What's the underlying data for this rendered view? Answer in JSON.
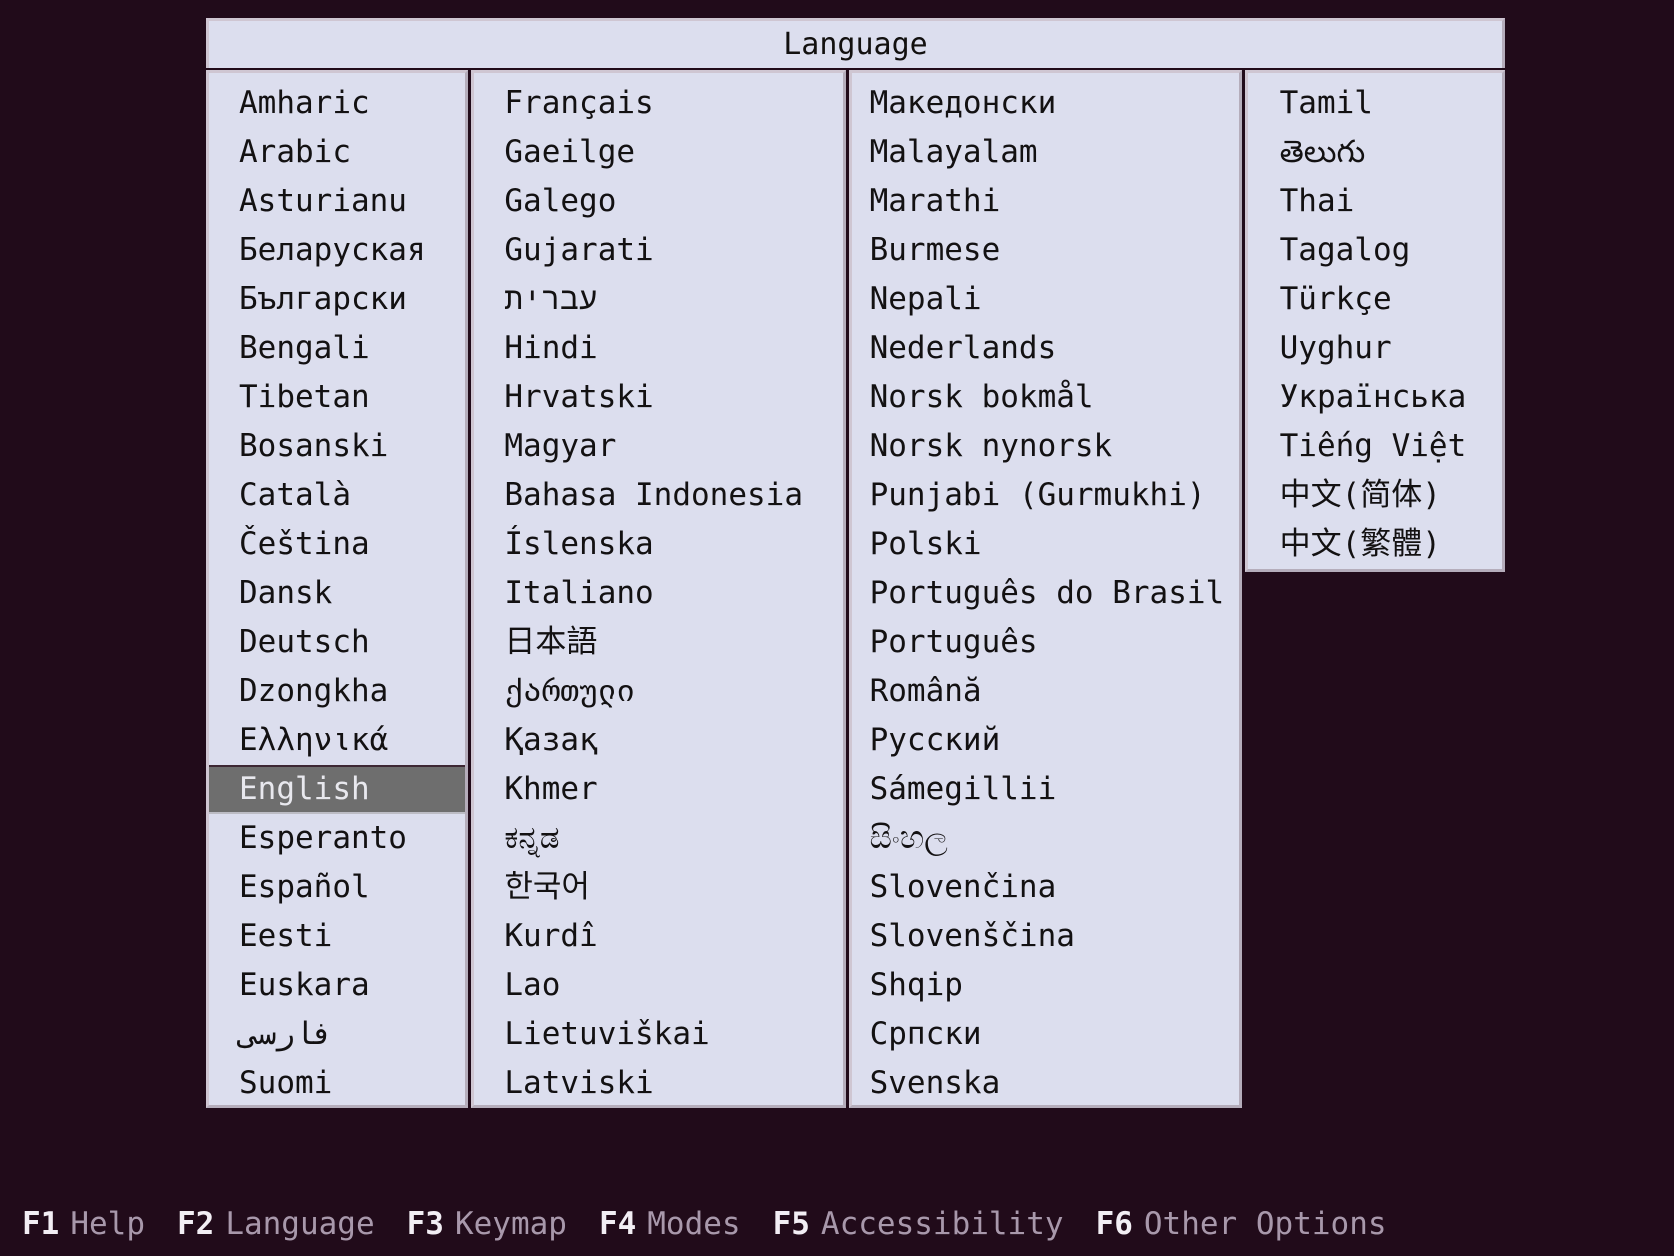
{
  "dialog": {
    "title": "Language",
    "columns": [
      {
        "name": "column-1",
        "items": [
          {
            "label": "Amharic",
            "selected": false
          },
          {
            "label": "Arabic",
            "selected": false
          },
          {
            "label": "Asturianu",
            "selected": false
          },
          {
            "label": "Беларуская",
            "selected": false
          },
          {
            "label": "Български",
            "selected": false
          },
          {
            "label": "Bengali",
            "selected": false
          },
          {
            "label": "Tibetan",
            "selected": false
          },
          {
            "label": "Bosanski",
            "selected": false
          },
          {
            "label": "Català",
            "selected": false
          },
          {
            "label": "Čeština",
            "selected": false
          },
          {
            "label": "Dansk",
            "selected": false
          },
          {
            "label": "Deutsch",
            "selected": false
          },
          {
            "label": "Dzongkha",
            "selected": false
          },
          {
            "label": "Ελληνικά",
            "selected": false
          },
          {
            "label": "English",
            "selected": true
          },
          {
            "label": "Esperanto",
            "selected": false
          },
          {
            "label": "Español",
            "selected": false
          },
          {
            "label": "Eesti",
            "selected": false
          },
          {
            "label": "Euskara",
            "selected": false
          },
          {
            "label": "فارسی",
            "selected": false
          },
          {
            "label": "Suomi",
            "selected": false
          }
        ]
      },
      {
        "name": "column-2",
        "items": [
          {
            "label": "Français",
            "selected": false
          },
          {
            "label": "Gaeilge",
            "selected": false
          },
          {
            "label": "Galego",
            "selected": false
          },
          {
            "label": "Gujarati",
            "selected": false
          },
          {
            "label": "עברית",
            "selected": false
          },
          {
            "label": "Hindi",
            "selected": false
          },
          {
            "label": "Hrvatski",
            "selected": false
          },
          {
            "label": "Magyar",
            "selected": false
          },
          {
            "label": "Bahasa Indonesia",
            "selected": false
          },
          {
            "label": "Íslenska",
            "selected": false
          },
          {
            "label": "Italiano",
            "selected": false
          },
          {
            "label": "日本語",
            "selected": false
          },
          {
            "label": "ქართული",
            "selected": false
          },
          {
            "label": "Қазақ",
            "selected": false
          },
          {
            "label": "Khmer",
            "selected": false
          },
          {
            "label": "ಕನ್ನಡ",
            "selected": false
          },
          {
            "label": "한국어",
            "selected": false
          },
          {
            "label": "Kurdî",
            "selected": false
          },
          {
            "label": "Lao",
            "selected": false
          },
          {
            "label": "Lietuviškai",
            "selected": false
          },
          {
            "label": "Latviski",
            "selected": false
          }
        ]
      },
      {
        "name": "column-3",
        "items": [
          {
            "label": "Македонски",
            "selected": false
          },
          {
            "label": "Malayalam",
            "selected": false
          },
          {
            "label": "Marathi",
            "selected": false
          },
          {
            "label": "Burmese",
            "selected": false
          },
          {
            "label": "Nepali",
            "selected": false
          },
          {
            "label": "Nederlands",
            "selected": false
          },
          {
            "label": "Norsk bokmål",
            "selected": false
          },
          {
            "label": "Norsk nynorsk",
            "selected": false
          },
          {
            "label": "Punjabi (Gurmukhi)",
            "selected": false
          },
          {
            "label": "Polski",
            "selected": false
          },
          {
            "label": "Português do Brasil",
            "selected": false
          },
          {
            "label": "Português",
            "selected": false
          },
          {
            "label": "Română",
            "selected": false
          },
          {
            "label": "Русский",
            "selected": false
          },
          {
            "label": "Sámegillii",
            "selected": false
          },
          {
            "label": "සිංහල",
            "selected": false
          },
          {
            "label": "Slovenčina",
            "selected": false
          },
          {
            "label": "Slovenščina",
            "selected": false
          },
          {
            "label": "Shqip",
            "selected": false
          },
          {
            "label": "Српски",
            "selected": false
          },
          {
            "label": "Svenska",
            "selected": false
          }
        ]
      },
      {
        "name": "column-4",
        "items": [
          {
            "label": "Tamil",
            "selected": false
          },
          {
            "label": "తెలుగు",
            "selected": false
          },
          {
            "label": "Thai",
            "selected": false
          },
          {
            "label": "Tagalog",
            "selected": false
          },
          {
            "label": "Türkçe",
            "selected": false
          },
          {
            "label": "Uyghur",
            "selected": false
          },
          {
            "label": "Українська",
            "selected": false
          },
          {
            "label": "Tiếng Việt",
            "selected": false
          },
          {
            "label": "中文(简体)",
            "selected": false
          },
          {
            "label": "中文(繁體)",
            "selected": false
          }
        ]
      }
    ]
  },
  "function_bar": {
    "keys": [
      {
        "key": "F1",
        "label": "Help"
      },
      {
        "key": "F2",
        "label": "Language"
      },
      {
        "key": "F3",
        "label": "Keymap"
      },
      {
        "key": "F4",
        "label": "Modes"
      },
      {
        "key": "F5",
        "label": "Accessibility"
      },
      {
        "key": "F6",
        "label": "Other Options"
      }
    ]
  },
  "colors": {
    "background": "#210b1a",
    "panel": "#dcdeee",
    "text": "#131112",
    "selection_background": "#6e6e6e",
    "selection_text": "#e8e8ee",
    "fkey": "#f2eef4",
    "flabel": "#a898ab"
  }
}
